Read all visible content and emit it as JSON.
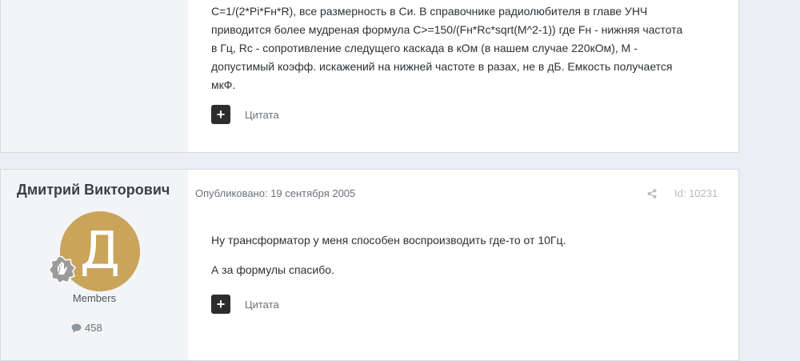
{
  "post1": {
    "lines": [
      "C=1/(2*Pi*Fн*R), все размерность в Си. В справочнике радиолюбителя в главе УНЧ",
      "приводится более мудреная формула C>=150/(Fн*Rc*sqrt(M^2-1)) где Fн - нижняя частота",
      "в Гц, Rc - сопротивление следущего каскада в кОм (в нашем случае 220кОм), М -",
      "допустимый коэфф. искажений на нижней частоте в разах, не в дБ. Емкость получается",
      "мкФ."
    ],
    "quote_label": "Цитата",
    "plus": "+"
  },
  "post2": {
    "author_name": "Дмитрий Викторович",
    "avatar_letter": "Д",
    "group": "Members",
    "post_count": "458",
    "published": "Опубликовано: 19 сентября 2005",
    "post_id": "Id: 10231",
    "paragraphs": [
      "Ну трансформатор у меня способен воспроизводить где-то от 10Гц.",
      "А за формулы спасибо."
    ],
    "quote_label": "Цитата",
    "plus": "+"
  },
  "colors": {
    "avatar_bg": "#c9a45a",
    "button_bg": "#2d2d2d",
    "author_panel_bg": "#f2f4f7"
  },
  "icons": [
    "plus-icon",
    "share-icon",
    "comment-icon",
    "rank-badge-icon"
  ]
}
